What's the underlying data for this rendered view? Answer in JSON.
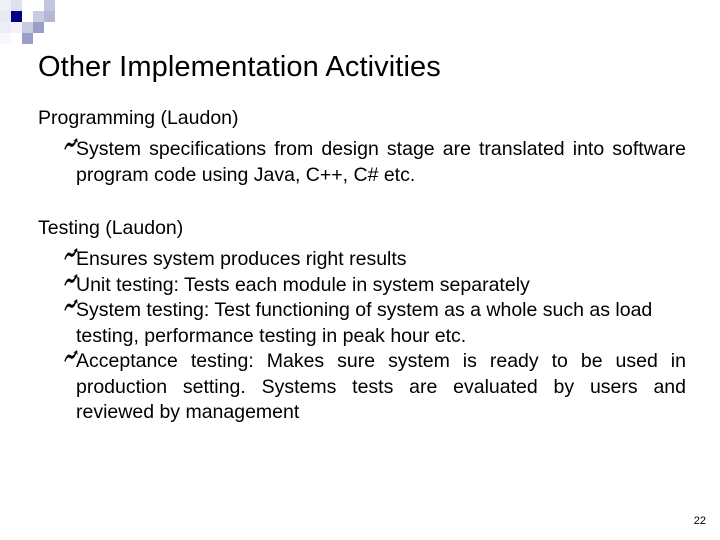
{
  "slide": {
    "title": "Other Implementation Activities",
    "page_number": "22",
    "bullet_icon": "curved-arrow-bullet-icon",
    "colors": {
      "gradient_start": "#1e2372",
      "gradient_end": "#ffffff",
      "deco_dark": "#000080",
      "deco_mid": "#9a9ecb",
      "deco_light": "#c9cbe2",
      "deco_pale": "#e6e7f2",
      "text": "#000000"
    }
  },
  "sections": [
    {
      "heading": "Programming (Laudon)",
      "bullets": [
        {
          "text": "System specifications from design stage are translated into software program code using Java, C++, C# etc.",
          "justified": true
        }
      ]
    },
    {
      "heading": "Testing (Laudon)",
      "bullets": [
        {
          "text": "Ensures system produces right results",
          "justified": false
        },
        {
          "text": "Unit testing: Tests each module in system separately",
          "justified": false
        },
        {
          "text": "System testing: Test functioning of system as a whole such as load testing, performance testing in peak hour etc.",
          "justified": false
        },
        {
          "text": "Acceptance testing: Makes sure system is ready to be used in production setting. Systems tests are evaluated by users and reviewed by management",
          "justified": true
        }
      ]
    }
  ]
}
